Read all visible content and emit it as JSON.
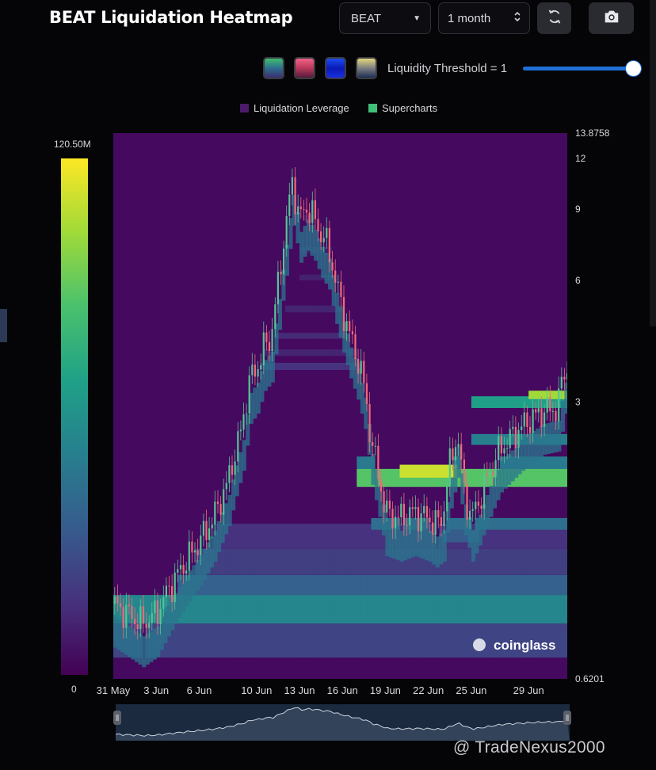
{
  "header": {
    "title": "BEAT Liquidation Heatmap",
    "symbol_value": "BEAT",
    "range_value": "1 month",
    "refresh_icon": "refresh-icon",
    "camera_icon": "camera-icon"
  },
  "toolbar": {
    "threshold_label": "Liquidity Threshold = 1",
    "threshold_value": 1,
    "palettes": [
      {
        "name": "viridis",
        "colors": [
          "#3fbd6e",
          "#2e6f8f",
          "#3a2f6e"
        ]
      },
      {
        "name": "red-pink",
        "colors": [
          "#f06287",
          "#b9385b",
          "#551b3a"
        ]
      },
      {
        "name": "blue",
        "colors": [
          "#1d4cf0",
          "#0a1ab5",
          "#1a2fe0"
        ]
      },
      {
        "name": "cividis",
        "colors": [
          "#e3d87a",
          "#7c7e80",
          "#1c2f55"
        ]
      }
    ]
  },
  "legend": {
    "items": [
      {
        "label": "Liquidation Leverage",
        "color": "#4b1a6b"
      },
      {
        "label": "Supercharts",
        "color": "#3fbf77"
      }
    ]
  },
  "colorbar": {
    "max_label": "120.50M",
    "min_label": "0"
  },
  "watermark": {
    "brand": "coinglass",
    "credit": "@ TradeNexus2000"
  },
  "chart_data": {
    "type": "heatmap",
    "title": "BEAT Liquidation Heatmap",
    "xlabel": "",
    "ylabel": "",
    "y_scale": "log",
    "ylim": [
      0.6201,
      13.8758
    ],
    "y_tick_labels": [
      "13.8758",
      "12",
      "9",
      "6",
      "3",
      "0.6201"
    ],
    "y_ticks": [
      13.8758,
      12,
      9,
      6,
      3,
      0.6201
    ],
    "x_tick_labels": [
      "31 May",
      "3 Jun",
      "6 Jun",
      "10 Jun",
      "13 Jun",
      "16 Jun",
      "19 Jun",
      "22 Jun",
      "25 Jun",
      "29 Jun"
    ],
    "x_ticks_day": [
      0,
      3,
      6,
      10,
      13,
      16,
      19,
      22,
      25,
      29
    ],
    "x_range_days": [
      0,
      31.7
    ],
    "colorscale": "viridis",
    "color_range": [
      0,
      120500000
    ],
    "price_series": {
      "name": "Supercharts",
      "day": [
        0,
        1,
        2,
        3,
        4,
        5,
        6,
        7,
        8,
        9,
        9.5,
        10,
        10.5,
        11,
        11.5,
        12,
        12.5,
        13,
        13.5,
        14,
        14.5,
        15,
        15.5,
        16,
        16.5,
        17,
        17.5,
        18,
        19,
        20,
        21,
        22,
        22.5,
        23,
        23.5,
        24,
        24.5,
        25,
        25.5,
        26,
        27,
        28,
        29,
        30,
        31,
        31.5
      ],
      "price": [
        0.95,
        0.9,
        0.85,
        0.9,
        1.05,
        1.2,
        1.35,
        1.55,
        1.9,
        2.6,
        3.4,
        3.6,
        4.1,
        4.3,
        5.8,
        7.9,
        10.5,
        8.5,
        9.1,
        8.6,
        7.8,
        7.3,
        6.0,
        5.1,
        4.4,
        3.9,
        3.3,
        2.4,
        1.6,
        1.55,
        1.6,
        1.55,
        1.5,
        1.55,
        2.1,
        2.5,
        1.8,
        1.55,
        1.7,
        1.9,
        2.3,
        2.5,
        2.7,
        2.85,
        2.9,
        3.6
      ]
    },
    "liquidity_bands": [
      {
        "from_day": 0,
        "to_day": 31.7,
        "low": 0.85,
        "high": 1.0,
        "intensity": 0.45
      },
      {
        "from_day": 0,
        "to_day": 31.7,
        "low": 1.0,
        "high": 1.12,
        "intensity": 0.3
      },
      {
        "from_day": 0,
        "to_day": 31.7,
        "low": 1.12,
        "high": 1.3,
        "intensity": 0.18
      },
      {
        "from_day": 0,
        "to_day": 31.7,
        "low": 0.7,
        "high": 0.85,
        "intensity": 0.2
      },
      {
        "from_day": 6,
        "to_day": 31.7,
        "low": 1.3,
        "high": 1.5,
        "intensity": 0.14
      },
      {
        "from_day": 9,
        "to_day": 31.7,
        "low": 3.6,
        "high": 3.75,
        "intensity": 0.14
      },
      {
        "from_day": 9,
        "to_day": 31.7,
        "low": 3.9,
        "high": 4.05,
        "intensity": 0.1
      },
      {
        "from_day": 10,
        "to_day": 31.7,
        "low": 4.3,
        "high": 4.45,
        "intensity": 0.12
      },
      {
        "from_day": 12,
        "to_day": 31.7,
        "low": 5.0,
        "high": 5.2,
        "intensity": 0.1
      },
      {
        "from_day": 13,
        "to_day": 31.7,
        "low": 6.0,
        "high": 6.2,
        "intensity": 0.09
      },
      {
        "from_day": 13,
        "to_day": 31.7,
        "low": 7.0,
        "high": 7.25,
        "intensity": 0.07
      },
      {
        "from_day": 13,
        "to_day": 31.7,
        "low": 8.4,
        "high": 8.7,
        "intensity": 0.07
      },
      {
        "from_day": 13,
        "to_day": 31.7,
        "low": 9.9,
        "high": 10.2,
        "intensity": 0.06
      },
      {
        "from_day": 13,
        "to_day": 31.7,
        "low": 12.1,
        "high": 12.5,
        "intensity": 0.05
      },
      {
        "from_day": 17,
        "to_day": 31.7,
        "low": 1.85,
        "high": 2.05,
        "intensity": 0.72
      },
      {
        "from_day": 17,
        "to_day": 31.7,
        "low": 2.05,
        "high": 2.2,
        "intensity": 0.4
      },
      {
        "from_day": 20,
        "to_day": 24,
        "low": 1.95,
        "high": 2.1,
        "intensity": 0.92
      },
      {
        "from_day": 25,
        "to_day": 31.7,
        "low": 2.9,
        "high": 3.1,
        "intensity": 0.55
      },
      {
        "from_day": 29,
        "to_day": 31.7,
        "low": 3.05,
        "high": 3.2,
        "intensity": 0.85
      },
      {
        "from_day": 25,
        "to_day": 31.7,
        "low": 2.35,
        "high": 2.5,
        "intensity": 0.42
      },
      {
        "from_day": 18,
        "to_day": 31.7,
        "low": 1.45,
        "high": 1.55,
        "intensity": 0.35
      },
      {
        "from_day": 23,
        "to_day": 25.5,
        "low": 1.35,
        "high": 1.45,
        "intensity": 0.28
      }
    ]
  }
}
